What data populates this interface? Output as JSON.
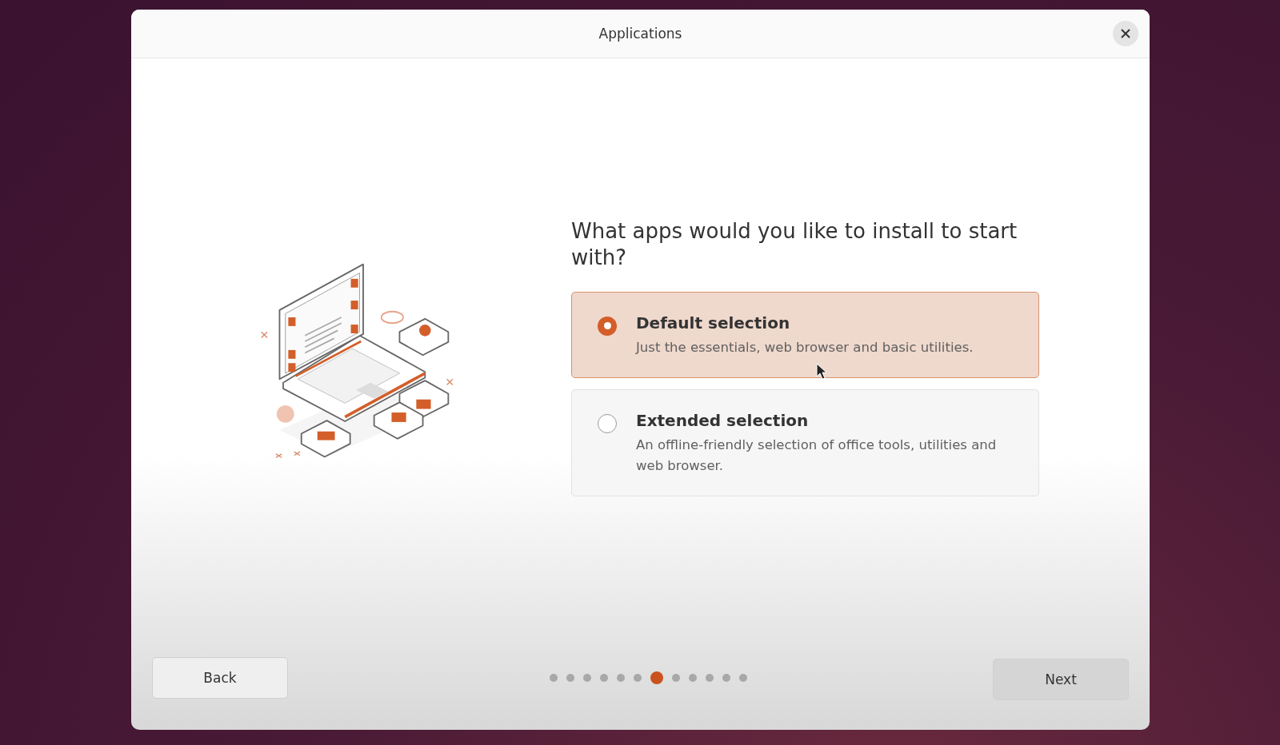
{
  "window": {
    "title": "Applications"
  },
  "question": "What apps would you like to install to start with?",
  "options": [
    {
      "title": "Default selection",
      "description": "Just the essentials, web browser and basic utilities.",
      "selected": true
    },
    {
      "title": "Extended selection",
      "description": "An offline-friendly selection of office tools, utilities and web browser.",
      "selected": false
    }
  ],
  "steps": [
    {
      "selected": false
    },
    {
      "selected": false
    },
    {
      "selected": false
    },
    {
      "selected": false
    },
    {
      "selected": false
    },
    {
      "selected": false
    },
    {
      "selected": true
    },
    {
      "selected": false
    },
    {
      "selected": false
    },
    {
      "selected": false
    },
    {
      "selected": false
    },
    {
      "selected": false
    }
  ],
  "buttons": {
    "back": "Back",
    "next": "Next"
  }
}
